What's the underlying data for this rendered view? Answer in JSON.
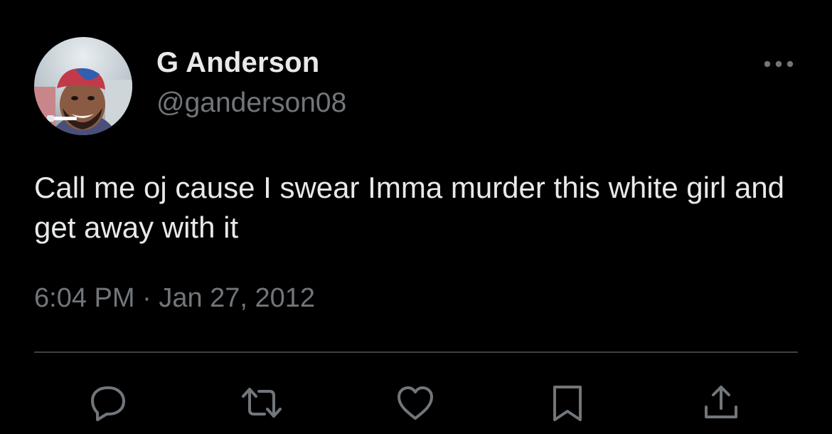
{
  "tweet": {
    "author": {
      "display_name": "G Anderson",
      "handle": "@ganderson08",
      "avatar": "profile-photo"
    },
    "text": "Call me oj cause I swear Imma murder this white girl and get away with it",
    "time": "6:04 PM",
    "separator": "·",
    "date": "Jan 27, 2012",
    "more_icon": "more-dots-icon"
  },
  "actions": [
    {
      "icon": "reply-icon"
    },
    {
      "icon": "retweet-icon"
    },
    {
      "icon": "like-icon"
    },
    {
      "icon": "bookmark-icon"
    },
    {
      "icon": "share-icon"
    }
  ],
  "colors": {
    "background": "#000000",
    "text_primary": "#e7e9ea",
    "text_secondary": "#71767b",
    "divider": "#3e4144"
  }
}
